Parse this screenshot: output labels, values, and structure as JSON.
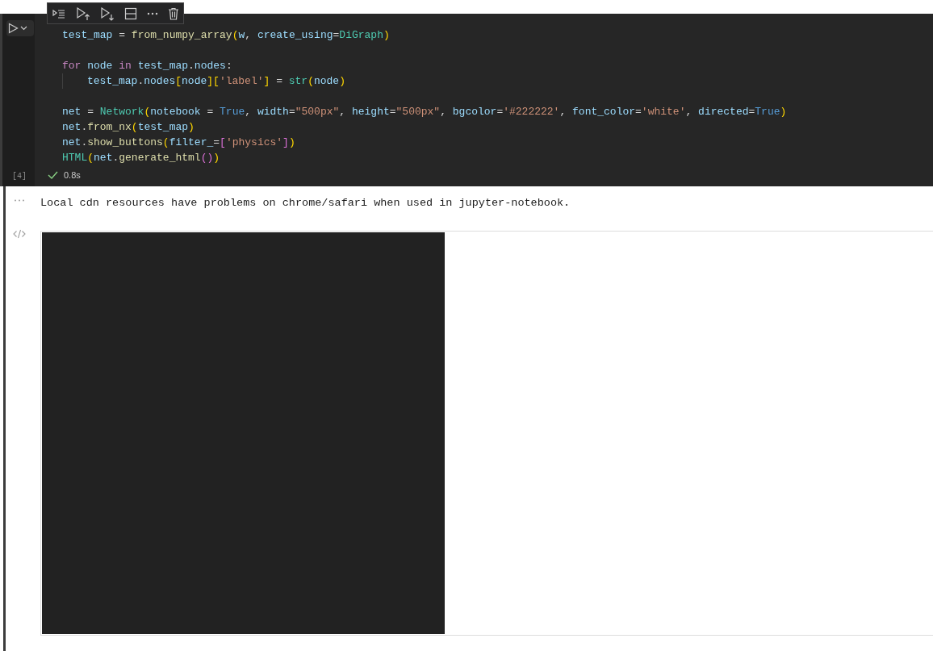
{
  "cell_toolbar": {
    "buttons": [
      {
        "kind": "run-by-line"
      },
      {
        "kind": "run-above"
      },
      {
        "kind": "run-below"
      },
      {
        "kind": "split"
      },
      {
        "kind": "more"
      },
      {
        "kind": "delete"
      }
    ]
  },
  "code_cell": {
    "execution_count": "[4]",
    "succeeded": true,
    "duration": "0.8s",
    "lines": [
      {
        "kind": "code",
        "tokens": [
          {
            "text": "test_map",
            "kind": "var"
          },
          {
            "text": " = ",
            "kind": "plain"
          },
          {
            "text": "from_numpy_array",
            "kind": "func"
          },
          {
            "text": "(",
            "kind": "b1"
          },
          {
            "text": "w",
            "kind": "var"
          },
          {
            "text": ", ",
            "kind": "plain"
          },
          {
            "text": "create_using",
            "kind": "var"
          },
          {
            "text": "=",
            "kind": "plain"
          },
          {
            "text": "DiGraph",
            "kind": "class"
          },
          {
            "text": ")",
            "kind": "b1"
          }
        ]
      },
      {
        "kind": "blank"
      },
      {
        "kind": "code",
        "tokens": [
          {
            "text": "for",
            "kind": "keyword"
          },
          {
            "text": " node ",
            "kind": "var"
          },
          {
            "text": "in",
            "kind": "keyword"
          },
          {
            "text": " test_map",
            "kind": "var"
          },
          {
            "text": ".",
            "kind": "plain"
          },
          {
            "text": "nodes",
            "kind": "var"
          },
          {
            "text": ":",
            "kind": "plain"
          }
        ]
      },
      {
        "kind": "indented",
        "tokens": [
          {
            "text": "test_map",
            "kind": "var"
          },
          {
            "text": ".",
            "kind": "plain"
          },
          {
            "text": "nodes",
            "kind": "var"
          },
          {
            "text": "[",
            "kind": "b1"
          },
          {
            "text": "node",
            "kind": "var"
          },
          {
            "text": "]",
            "kind": "b1"
          },
          {
            "text": "[",
            "kind": "b1"
          },
          {
            "text": "'label'",
            "kind": "string"
          },
          {
            "text": "]",
            "kind": "b1"
          },
          {
            "text": " = ",
            "kind": "plain"
          },
          {
            "text": "str",
            "kind": "class"
          },
          {
            "text": "(",
            "kind": "b1"
          },
          {
            "text": "node",
            "kind": "var"
          },
          {
            "text": ")",
            "kind": "b1"
          }
        ]
      },
      {
        "kind": "blank"
      },
      {
        "kind": "code",
        "tokens": [
          {
            "text": "net",
            "kind": "var"
          },
          {
            "text": " = ",
            "kind": "plain"
          },
          {
            "text": "Network",
            "kind": "class"
          },
          {
            "text": "(",
            "kind": "b1"
          },
          {
            "text": "notebook",
            "kind": "var"
          },
          {
            "text": " = ",
            "kind": "plain"
          },
          {
            "text": "True",
            "kind": "const"
          },
          {
            "text": ", ",
            "kind": "plain"
          },
          {
            "text": "width",
            "kind": "var"
          },
          {
            "text": "=",
            "kind": "plain"
          },
          {
            "text": "\"500px\"",
            "kind": "string"
          },
          {
            "text": ", ",
            "kind": "plain"
          },
          {
            "text": "height",
            "kind": "var"
          },
          {
            "text": "=",
            "kind": "plain"
          },
          {
            "text": "\"500px\"",
            "kind": "string"
          },
          {
            "text": ", ",
            "kind": "plain"
          },
          {
            "text": "bgcolor",
            "kind": "var"
          },
          {
            "text": "=",
            "kind": "plain"
          },
          {
            "text": "'#222222'",
            "kind": "string"
          },
          {
            "text": ", ",
            "kind": "plain"
          },
          {
            "text": "font_color",
            "kind": "var"
          },
          {
            "text": "=",
            "kind": "plain"
          },
          {
            "text": "'white'",
            "kind": "string"
          },
          {
            "text": ", ",
            "kind": "plain"
          },
          {
            "text": "directed",
            "kind": "var"
          },
          {
            "text": "=",
            "kind": "plain"
          },
          {
            "text": "True",
            "kind": "const"
          },
          {
            "text": ")",
            "kind": "b1"
          }
        ]
      },
      {
        "kind": "code",
        "tokens": [
          {
            "text": "net",
            "kind": "var"
          },
          {
            "text": ".",
            "kind": "plain"
          },
          {
            "text": "from_nx",
            "kind": "func"
          },
          {
            "text": "(",
            "kind": "b1"
          },
          {
            "text": "test_map",
            "kind": "var"
          },
          {
            "text": ")",
            "kind": "b1"
          }
        ]
      },
      {
        "kind": "code",
        "tokens": [
          {
            "text": "net",
            "kind": "var"
          },
          {
            "text": ".",
            "kind": "plain"
          },
          {
            "text": "show_buttons",
            "kind": "func"
          },
          {
            "text": "(",
            "kind": "b1"
          },
          {
            "text": "filter_",
            "kind": "var"
          },
          {
            "text": "=",
            "kind": "plain"
          },
          {
            "text": "[",
            "kind": "b2"
          },
          {
            "text": "'physics'",
            "kind": "string"
          },
          {
            "text": "]",
            "kind": "b2"
          },
          {
            "text": ")",
            "kind": "b1"
          }
        ]
      },
      {
        "kind": "code",
        "tokens": [
          {
            "text": "HTML",
            "kind": "class"
          },
          {
            "text": "(",
            "kind": "b1"
          },
          {
            "text": "net",
            "kind": "var"
          },
          {
            "text": ".",
            "kind": "plain"
          },
          {
            "text": "generate_html",
            "kind": "func"
          },
          {
            "text": "(",
            "kind": "b2"
          },
          {
            "text": ")",
            "kind": "b2"
          },
          {
            "text": ")",
            "kind": "b1"
          }
        ]
      }
    ]
  },
  "outputs": [
    {
      "kind": "text",
      "text": "Local cdn resources have problems on chrome/safari when used in jupyter-notebook."
    },
    {
      "kind": "html_frame"
    }
  ]
}
